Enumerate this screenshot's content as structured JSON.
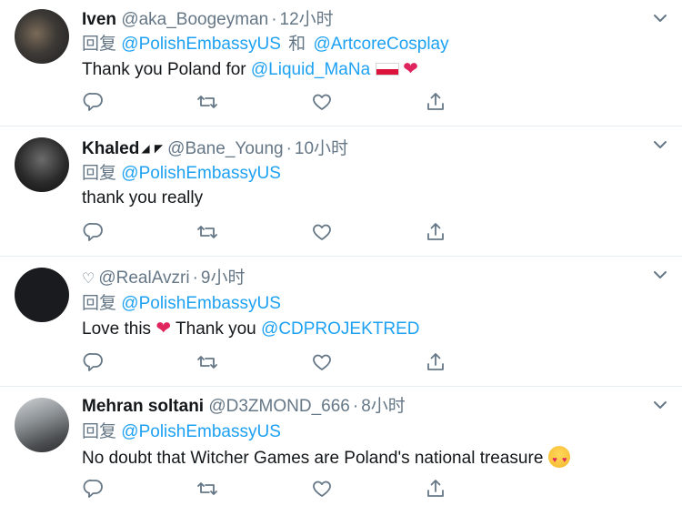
{
  "tweets": [
    {
      "name": "Iven",
      "handle": "@aka_Boogeyman",
      "time": "12小时",
      "reply_label": "回复",
      "reply_to": [
        "@PolishEmbassyUS",
        "@ArtcoreCosplay"
      ],
      "reply_joiner": "和",
      "text": "Thank you Poland for ",
      "text_mention": "@Liquid_MaNa"
    },
    {
      "name": "Khaled",
      "badge": "◢ ◤",
      "handle": "@Bane_Young",
      "time": "10小时",
      "reply_label": "回复",
      "reply_to": [
        "@PolishEmbassyUS"
      ],
      "text": "thank you really"
    },
    {
      "name_prefix": "♡",
      "handle": "@RealAvzri",
      "time": "9小时",
      "reply_label": "回复",
      "reply_to": [
        "@PolishEmbassyUS"
      ],
      "text_before": "Love this ",
      "text_after": " Thank you ",
      "text_mention": "@CDPROJEKTRED"
    },
    {
      "name": "Mehran soltani",
      "handle": "@D3ZMOND_666",
      "time": "8小时",
      "reply_label": "回复",
      "reply_to": [
        "@PolishEmbassyUS"
      ],
      "text": "No doubt that Witcher Games are Poland's national treasure"
    }
  ],
  "separator": "·",
  "emoji": {
    "heart": "❤"
  },
  "icons": [
    "reply-icon",
    "retweet-icon",
    "like-icon",
    "share-icon",
    "chevron-down-icon"
  ],
  "colors": {
    "link": "#1da1f2",
    "muted": "#657786",
    "text": "#14171a",
    "heart": "#e0245e",
    "divider": "#e6ecf0"
  }
}
